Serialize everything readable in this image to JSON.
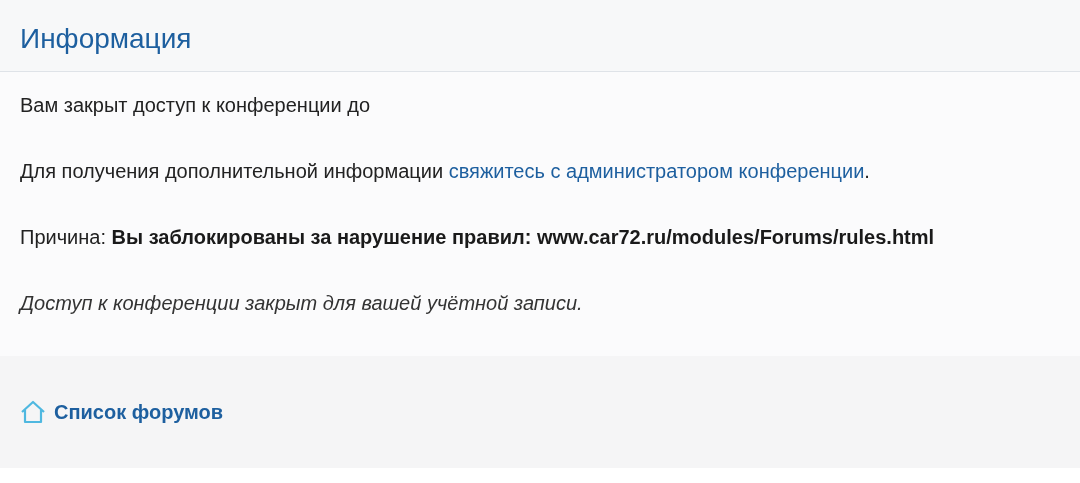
{
  "header": {
    "title": "Информация"
  },
  "message": {
    "lines": [
      {
        "kind": "plain",
        "text": "Вам закрыт доступ к конференции до"
      },
      {
        "kind": "link",
        "text": "Для получения дополнительной информации",
        "link": "свяжитесь с администратором конференции",
        "after": "."
      },
      {
        "kind": "reason",
        "text": "Причина:",
        "bold": "Вы заблокированы за нарушение правил: www.car72.ru/modules/Forums/rules.html"
      },
      {
        "kind": "italic",
        "text": "Доступ к конференции закрыт для вашей учётной записи."
      }
    ]
  },
  "footer": {
    "link": "Список форумов"
  }
}
